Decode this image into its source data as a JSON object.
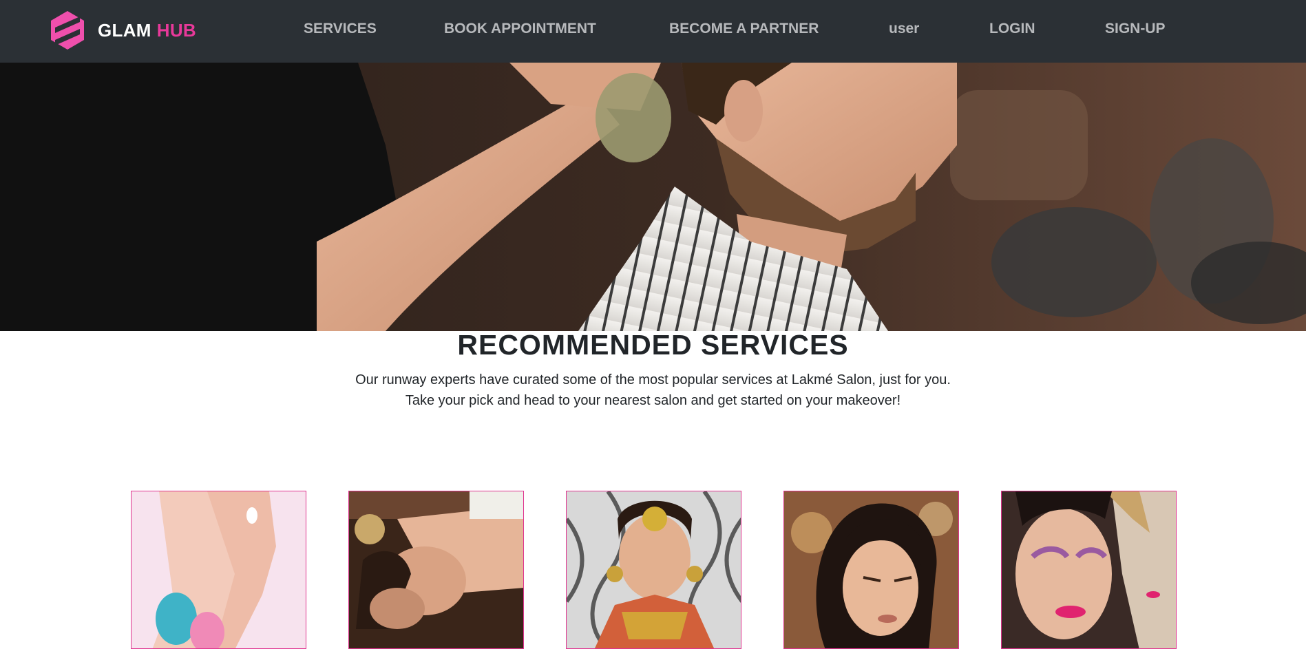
{
  "brand": {
    "name_part1": "GLAM",
    "name_part2": "HUB",
    "accent_color": "#e8399a",
    "logo_icon": "hexagon-stripes-logo"
  },
  "nav": {
    "services": "SERVICES",
    "book_appointment": "BOOK APPOINTMENT",
    "become_partner": "BECOME A PARTNER",
    "user": "user",
    "login": "LOGIN",
    "signup": "SIGN-UP"
  },
  "hero": {
    "image": "barber-styling-client-photo"
  },
  "recommended": {
    "title": "RECOMMENDED SERVICES",
    "line1": "Our runway experts have curated some of the most popular services at Lakmé Salon, just for you.",
    "line2": "Take your pick and head to your nearest salon and get started on your makeover!"
  },
  "cards": [
    {
      "image": "pedicure-feet-photo"
    },
    {
      "image": "head-massage-spa-photo"
    },
    {
      "image": "bridal-makeup-photo"
    },
    {
      "image": "hair-styling-photo"
    },
    {
      "image": "makeup-looks-photo"
    }
  ],
  "colors": {
    "navbar_bg": "#2b3035",
    "nav_text": "#b7b9bc",
    "card_border": "#e0338f",
    "heading_text": "#212529"
  }
}
